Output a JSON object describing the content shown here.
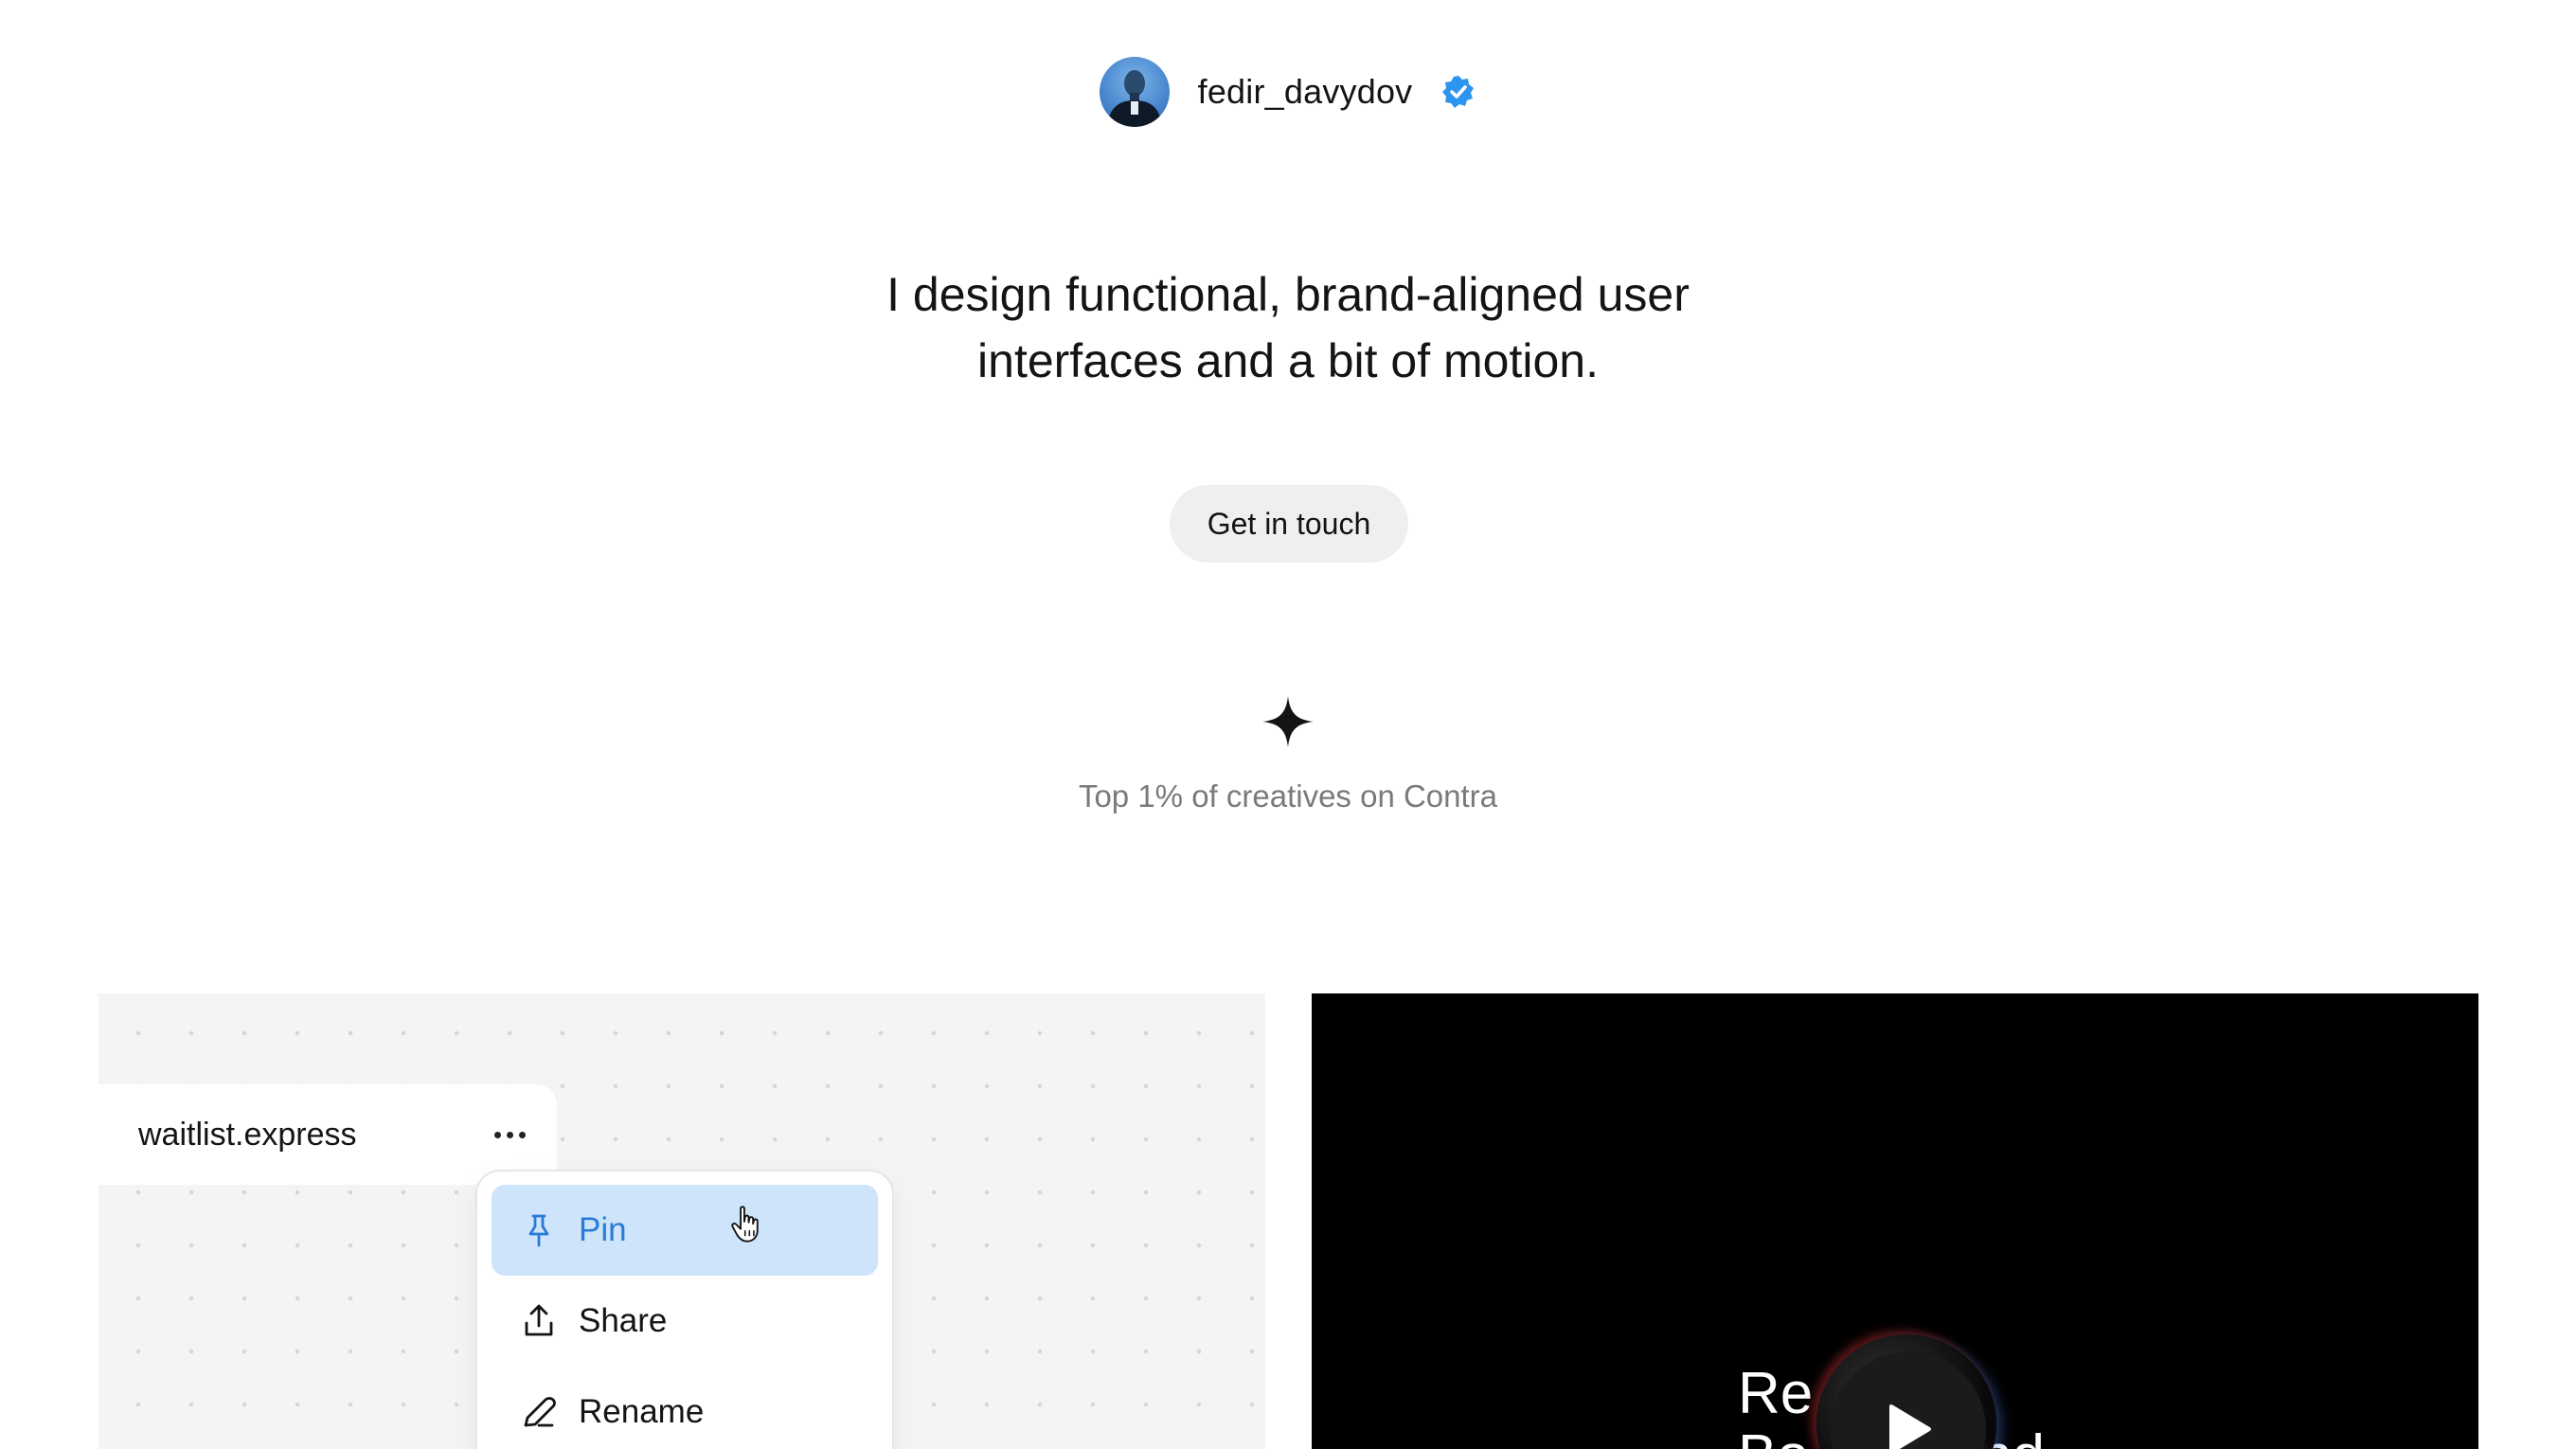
{
  "profile": {
    "username": "fedir_davydov",
    "verified_icon": "verified-badge-icon",
    "verified_color": "#2d95f0"
  },
  "headline": {
    "line1": "I design functional, brand-aligned user",
    "line2": "interfaces and a bit of motion."
  },
  "cta": {
    "label": "Get in touch"
  },
  "badge": {
    "icon": "sparkle-icon",
    "text": "Top 1% of creatives on Contra"
  },
  "projects": {
    "left_card": {
      "tab_label": "waitlist.express",
      "more_icon": "more-horizontal-icon",
      "menu": [
        {
          "label": "Pin",
          "icon": "pin-icon",
          "active": true
        },
        {
          "label": "Share",
          "icon": "share-icon",
          "active": false
        },
        {
          "label": "Rename",
          "icon": "pencil-icon",
          "active": false
        }
      ],
      "active_color": "#cde4fb",
      "active_text_color": "#2a7bd6"
    },
    "right_card": {
      "title_line1": "Re",
      "title_line2": "Ba",
      "title_fragment": "nd",
      "play_icon": "play-icon"
    }
  }
}
